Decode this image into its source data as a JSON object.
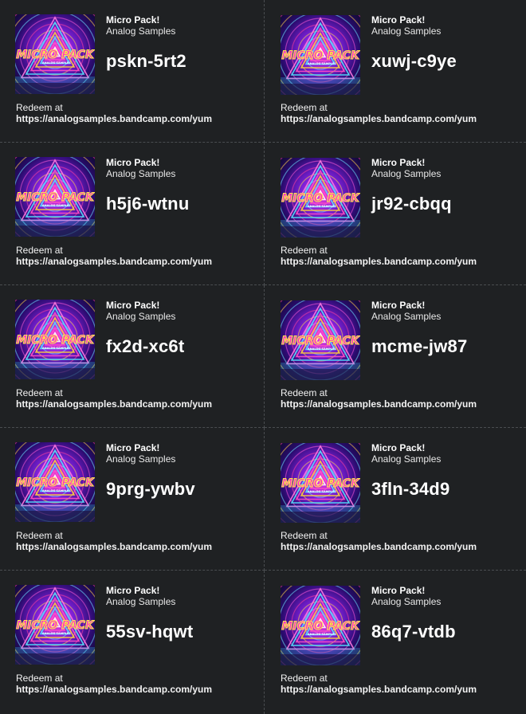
{
  "card": {
    "title": "Micro Pack!",
    "artist": "Analog Samples",
    "redeem_prefix": "Redeem at",
    "redeem_url": "https://analogsamples.bandcamp.com/yum",
    "art_label": "MICRO PACK",
    "art_sublabel": "ANALOG SAMPLES"
  },
  "codes": [
    "pskn-5rt2",
    "xuwj-c9ye",
    "h5j6-wtnu",
    "jr92-cbqq",
    "fx2d-xc6t",
    "mcme-jw87",
    "9prg-ywbv",
    "3fln-34d9",
    "55sv-hqwt",
    "86q7-vtdb"
  ],
  "colors": {
    "background": "#1f2123",
    "divider": "#4a4d50",
    "text": "#ffffff"
  }
}
